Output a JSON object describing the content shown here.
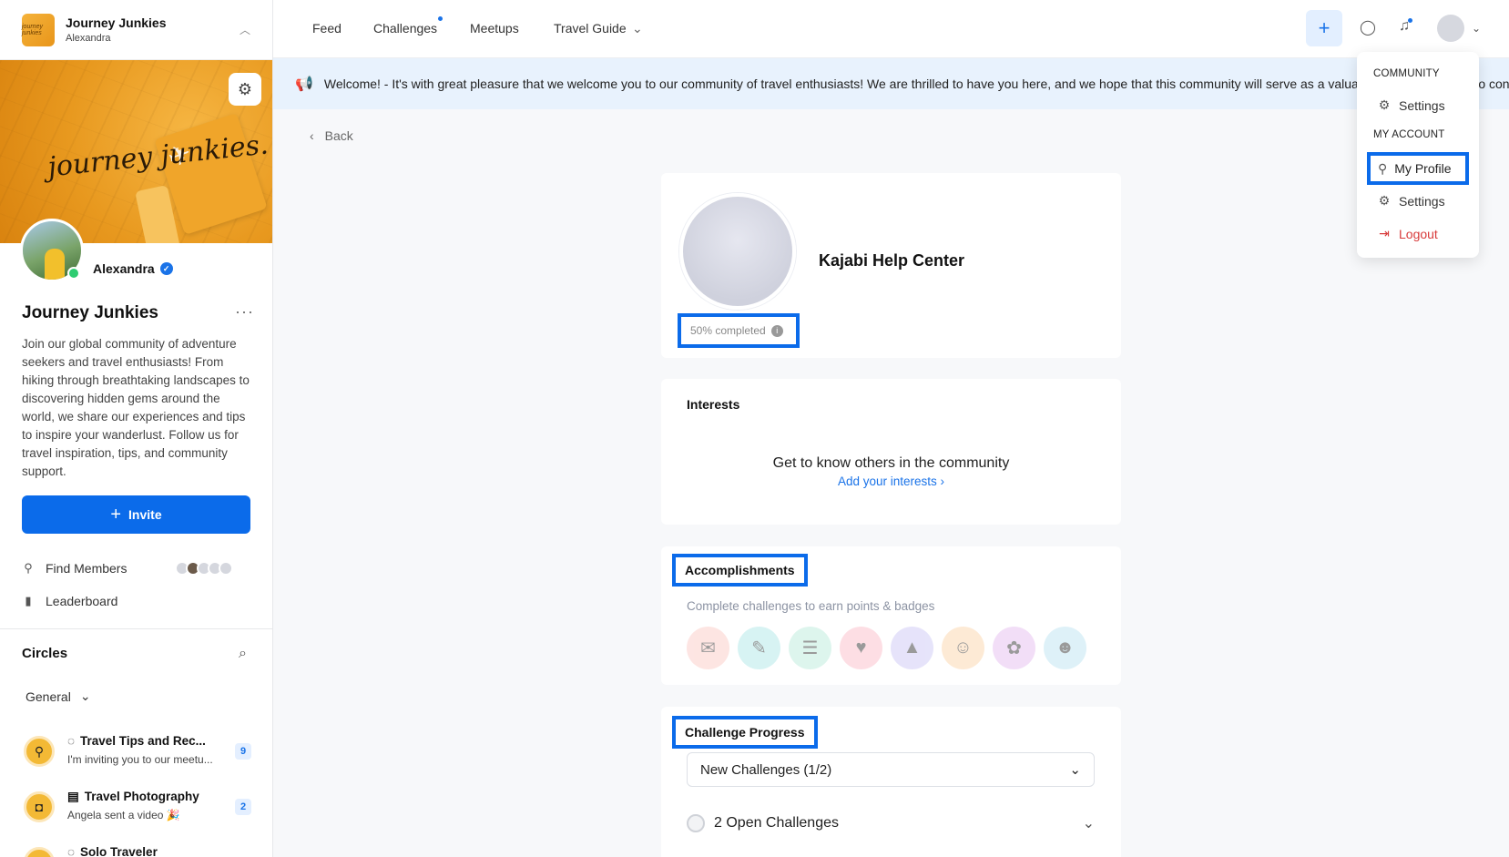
{
  "sidebar": {
    "community_name": "Journey Junkies",
    "user_name": "Alexandra",
    "logo_text": "journey junkies",
    "banner_script": "journey junkies.",
    "owner_name": "Alexandra",
    "title": "Journey Junkies",
    "description": "Join our global community of adventure seekers and travel enthusiasts! From hiking through breathtaking landscapes to discovering hidden gems around the world, we share our experiences and tips to inspire your wanderlust. Follow us for travel inspiration, tips, and community support.",
    "invite_label": "Invite",
    "find_members_label": "Find Members",
    "leaderboard_label": "Leaderboard",
    "circles_heading": "Circles",
    "general_label": "General",
    "circles": [
      {
        "title": "Travel Tips and Rec...",
        "subtitle": "I'm inviting you to our meetu...",
        "count": "9"
      },
      {
        "title": "Travel Photography",
        "subtitle": "Angela sent a video 🎉",
        "count": "2"
      },
      {
        "title": "Solo Traveler",
        "subtitle": "",
        "count": ""
      }
    ]
  },
  "topnav": {
    "items": [
      "Feed",
      "Challenges",
      "Meetups",
      "Travel Guide"
    ],
    "accent": "#1a73e8"
  },
  "welcome": {
    "text": "Welcome! - It's with great pleasure that we welcome you to our community of travel enthusiasts! We are thrilled to have you here, and we hope that this community will serve as a valuable resource for you to connect, learn, and share your travel experiences. Read more about the community"
  },
  "main": {
    "back_label": "Back",
    "profile_name": "Kajabi Help Center",
    "completed_label": "50% completed",
    "completed_value": 0.5,
    "interests_heading": "Interests",
    "interests_prompt": "Get to know others in the community",
    "add_interests_label": "Add your interests",
    "accomplishments_heading": "Accomplishments",
    "accomplishments_sub": "Complete challenges to earn points & badges",
    "challenge_heading": "Challenge Progress",
    "challenge_select": "New Challenges (1/2)",
    "open_challenges": "2 Open Challenges"
  },
  "dropdown": {
    "community_heading": "COMMUNITY",
    "community_settings": "Settings",
    "account_heading": "MY ACCOUNT",
    "my_profile": "My Profile",
    "account_settings": "Settings",
    "logout": "Logout"
  },
  "colors": {
    "primary": "#0b6bea",
    "danger": "#d83a3a",
    "banner": "#e8991f"
  },
  "icons": [
    "chevron-up-icon",
    "gear-icon",
    "plane-icon",
    "verified-icon",
    "more-icon",
    "plus-icon",
    "user-icon",
    "leaderboard-icon",
    "search-icon",
    "chevron-down-icon",
    "chat-icon",
    "bell-icon",
    "megaphone-icon",
    "chevron-left-icon",
    "info-icon",
    "chevron-right-icon",
    "logout-icon"
  ]
}
